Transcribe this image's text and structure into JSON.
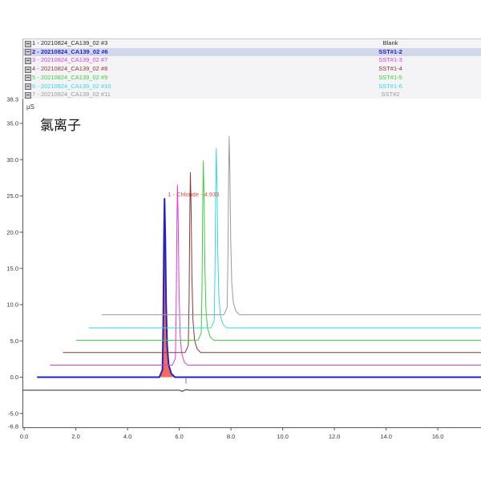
{
  "chart_data": {
    "type": "line",
    "title": "氯离子",
    "ylabel": "µS",
    "xlim": [
      -0.05,
      17.67
    ],
    "ylim": [
      -6.8,
      38.3
    ],
    "y_range_labels": {
      "max": "38.3",
      "min": "-6.8"
    },
    "x_tick_labels": [
      "0.0",
      "2.0",
      "4.0",
      "6.0",
      "8.0",
      "10.0",
      "12.0",
      "14.0",
      "16.0"
    ],
    "y_tick_labels": [
      "-5.0",
      "0.0",
      "5.0",
      "10.0",
      "15.0",
      "20.0",
      "25.0",
      "30.0",
      "35.0"
    ],
    "grid": false,
    "legend": "top",
    "series": [
      {
        "name": "1 - 20210824_CA139_02 #3",
        "sample": "Blank",
        "color": "#2a2a2a",
        "points": [
          [
            -0.05,
            -1.8
          ],
          [
            6.0,
            -1.8
          ],
          [
            6.12,
            -1.95
          ],
          [
            6.25,
            -1.72
          ],
          [
            6.4,
            -1.8
          ],
          [
            17.67,
            -1.8
          ]
        ]
      },
      {
        "name": "2 - 20210824_CA139_02 #6",
        "sample": "SST#1-2",
        "color": "#2222c8",
        "selected": true,
        "points": [
          [
            0.5,
            0
          ],
          [
            5.23,
            0
          ],
          [
            5.35,
            1.0
          ],
          [
            5.38,
            7.4
          ],
          [
            5.41,
            19.7
          ],
          [
            5.43,
            24.6
          ],
          [
            5.46,
            19.2
          ],
          [
            5.49,
            10.3
          ],
          [
            5.53,
            4.4
          ],
          [
            5.59,
            1.7
          ],
          [
            5.69,
            0.5
          ],
          [
            5.83,
            0
          ],
          [
            17.67,
            0
          ]
        ],
        "peak_label": "1 - Chloride - 4.933",
        "peak_label_color": "#e8473a",
        "integration": {
          "from": 5.27,
          "to": 6.26,
          "fill": "#f26b5b"
        }
      },
      {
        "name": "3 - 20210824_CA139_02 #7",
        "sample": "SST#1-3",
        "color": "#e03ae0",
        "points": [
          [
            1.0,
            1.65
          ],
          [
            5.73,
            1.65
          ],
          [
            5.85,
            2.6
          ],
          [
            5.88,
            9.1
          ],
          [
            5.91,
            21.5
          ],
          [
            5.93,
            26.5
          ],
          [
            5.96,
            21.0
          ],
          [
            5.99,
            12.1
          ],
          [
            6.03,
            6.1
          ],
          [
            6.09,
            3.4
          ],
          [
            6.19,
            2.1
          ],
          [
            6.33,
            1.65
          ],
          [
            17.67,
            1.65
          ]
        ]
      },
      {
        "name": "4 - 20210824_CA139_02 #8",
        "sample": "SST#1-4",
        "color": "#8a3636",
        "points": [
          [
            1.5,
            3.4
          ],
          [
            6.23,
            3.4
          ],
          [
            6.35,
            4.4
          ],
          [
            6.38,
            10.8
          ],
          [
            6.41,
            23.2
          ],
          [
            6.43,
            28.2
          ],
          [
            6.46,
            22.7
          ],
          [
            6.49,
            13.8
          ],
          [
            6.53,
            7.9
          ],
          [
            6.59,
            5.1
          ],
          [
            6.69,
            3.9
          ],
          [
            6.83,
            3.4
          ],
          [
            17.67,
            3.4
          ]
        ]
      },
      {
        "name": "5 - 20210824_CA139_02 #9",
        "sample": "SST#1-5",
        "color": "#3ecb3e",
        "points": [
          [
            2.0,
            5.1
          ],
          [
            6.73,
            5.1
          ],
          [
            6.85,
            6.1
          ],
          [
            6.88,
            12.5
          ],
          [
            6.91,
            24.9
          ],
          [
            6.93,
            29.8
          ],
          [
            6.96,
            24.4
          ],
          [
            6.99,
            15.5
          ],
          [
            7.03,
            9.5
          ],
          [
            7.09,
            6.8
          ],
          [
            7.19,
            5.6
          ],
          [
            7.33,
            5.1
          ],
          [
            17.67,
            5.1
          ]
        ]
      },
      {
        "name": "6 - 20210824_CA139_02 #10",
        "sample": "SST#1-6",
        "color": "#2fd9ea",
        "points": [
          [
            2.5,
            6.8
          ],
          [
            7.23,
            6.8
          ],
          [
            7.35,
            7.8
          ],
          [
            7.38,
            14.2
          ],
          [
            7.41,
            26.6
          ],
          [
            7.43,
            31.5
          ],
          [
            7.46,
            26.1
          ],
          [
            7.49,
            17.2
          ],
          [
            7.53,
            11.3
          ],
          [
            7.59,
            8.5
          ],
          [
            7.69,
            7.3
          ],
          [
            7.83,
            6.8
          ],
          [
            17.67,
            6.8
          ]
        ]
      },
      {
        "name": "7 - 20210824_CA139_02 #11",
        "sample": "SST#2",
        "color": "#9a9a9a",
        "points": [
          [
            3.0,
            8.6
          ],
          [
            7.73,
            8.6
          ],
          [
            7.85,
            9.6
          ],
          [
            7.88,
            16.0
          ],
          [
            7.91,
            28.3
          ],
          [
            7.93,
            33.2
          ],
          [
            7.96,
            27.8
          ],
          [
            7.99,
            18.9
          ],
          [
            8.03,
            13.0
          ],
          [
            8.09,
            10.3
          ],
          [
            8.19,
            9.1
          ],
          [
            8.33,
            8.6
          ],
          [
            17.67,
            8.6
          ]
        ]
      }
    ]
  }
}
